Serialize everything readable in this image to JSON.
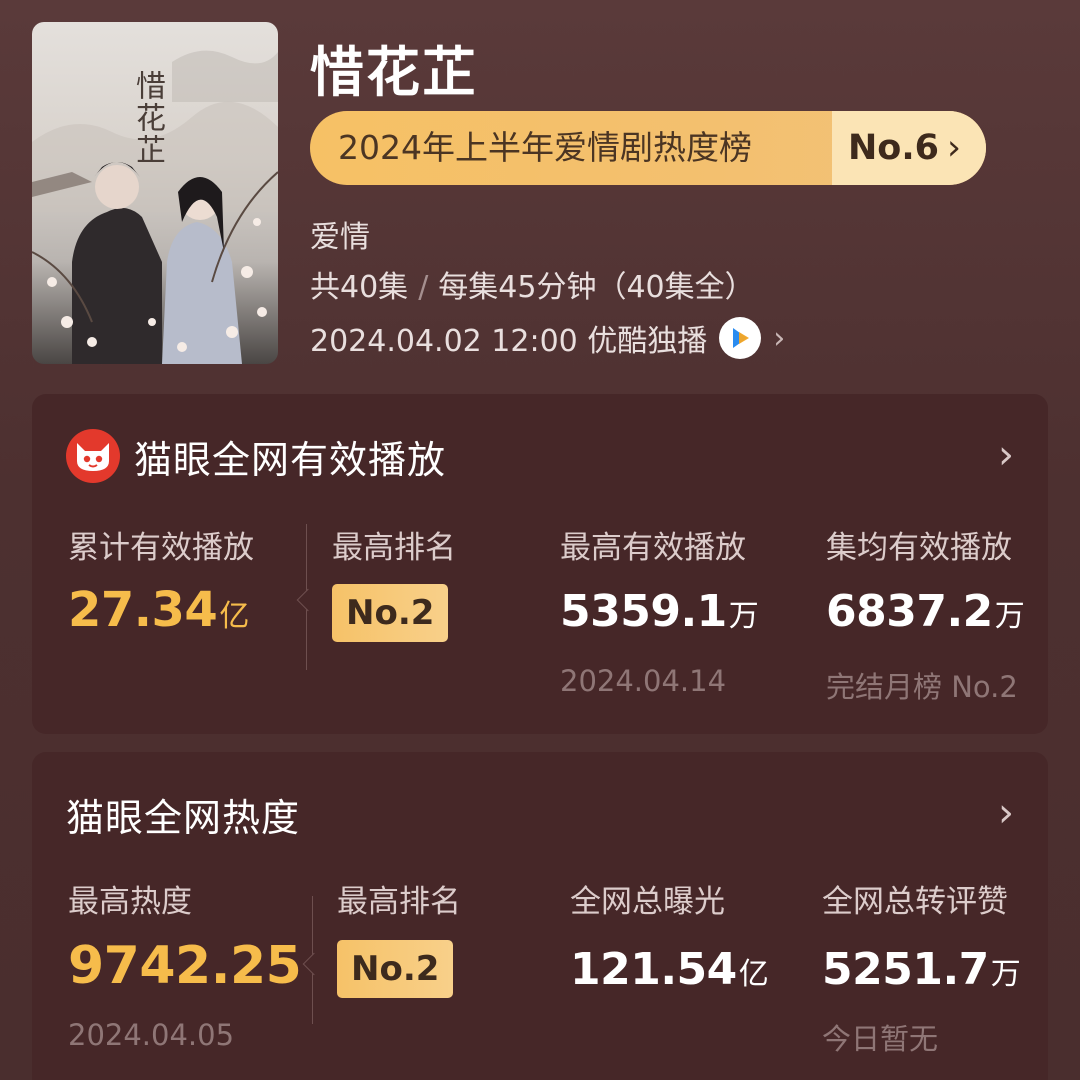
{
  "header": {
    "poster_title": "惜花芷",
    "title": "惜花芷",
    "ranking_label": "2024年上半年爱情剧热度榜",
    "ranking_no": "No.6",
    "genre": "爱情",
    "episodes": "共40集",
    "episode_info": "每集45分钟（40集全）",
    "release": "2024.04.02 12:00 优酷独播",
    "platform_icon": "youku-icon"
  },
  "cards": {
    "plays": {
      "icon": "maoyan-cat-icon",
      "title": "猫眼全网有效播放",
      "cumulative_label": "累计有效播放",
      "cumulative_value": "27.34",
      "cumulative_unit": "亿",
      "best_rank_label": "最高排名",
      "best_rank_value": "No.2",
      "peak_label": "最高有效播放",
      "peak_value": "5359.1",
      "peak_unit": "万",
      "peak_date": "2024.04.14",
      "avg_label": "集均有效播放",
      "avg_value": "6837.2",
      "avg_unit": "万",
      "avg_note": "完结月榜 No.2"
    },
    "heat": {
      "title": "猫眼全网热度",
      "peak_label": "最高热度",
      "peak_value": "9742.25",
      "peak_date": "2024.04.05",
      "best_rank_label": "最高排名",
      "best_rank_value": "No.2",
      "exposure_label": "全网总曝光",
      "exposure_value": "121.54",
      "exposure_unit": "亿",
      "engagement_label": "全网总转评赞",
      "engagement_value": "5251.7",
      "engagement_unit": "万",
      "engagement_note": "今日暂无"
    }
  },
  "colors": {
    "background": "#4d3030",
    "card": "#462728",
    "gold": "#f6bc4b",
    "pill": "#f6c165"
  }
}
